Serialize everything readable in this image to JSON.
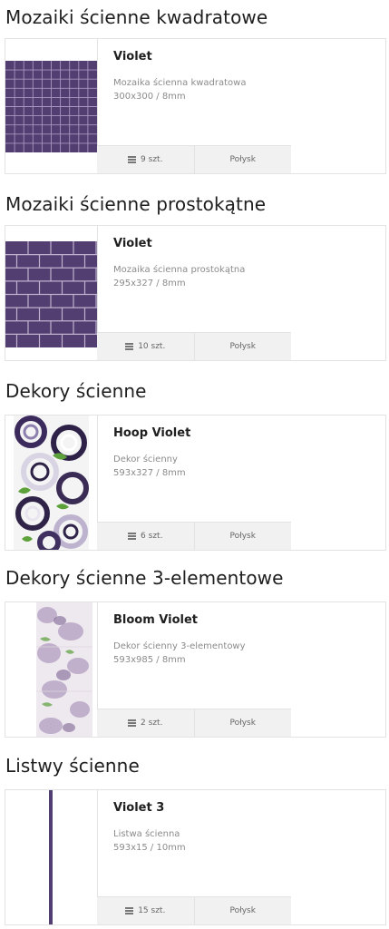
{
  "sections": [
    {
      "title": "Mozaiki ścienne kwadratowe",
      "product": {
        "name": "Violet",
        "type": "Mozaika ścienna kwadratowa",
        "size": "300x300 / 8mm",
        "pcs": "9 szt.",
        "finish": "Połysk"
      }
    },
    {
      "title": "Mozaiki ścienne prostokątne",
      "product": {
        "name": "Violet",
        "type": "Mozaika ścienna prostokątna",
        "size": "295x327 / 8mm",
        "pcs": "10 szt.",
        "finish": "Połysk"
      }
    },
    {
      "title": "Dekory ścienne",
      "product": {
        "name": "Hoop Violet",
        "type": "Dekor ścienny",
        "size": "593x327 / 8mm",
        "pcs": "6 szt.",
        "finish": "Połysk"
      }
    },
    {
      "title": "Dekory ścienne 3-elementowe",
      "product": {
        "name": "Bloom Violet",
        "type": "Dekor ścienny 3-elementowy",
        "size": "593x985 / 8mm",
        "pcs": "2 szt.",
        "finish": "Połysk"
      }
    },
    {
      "title": "Listwy ścienne",
      "product": {
        "name": "Violet 3",
        "type": "Listwa ścienna",
        "size": "593x15 / 10mm",
        "pcs": "15 szt.",
        "finish": "Połysk"
      }
    }
  ],
  "colors": {
    "violet": "#523e71",
    "grout": "#b8a9c6",
    "green": "#5da13a"
  },
  "icons": {
    "thumbnail": "tile-thumbnail",
    "package": "package-icon"
  }
}
